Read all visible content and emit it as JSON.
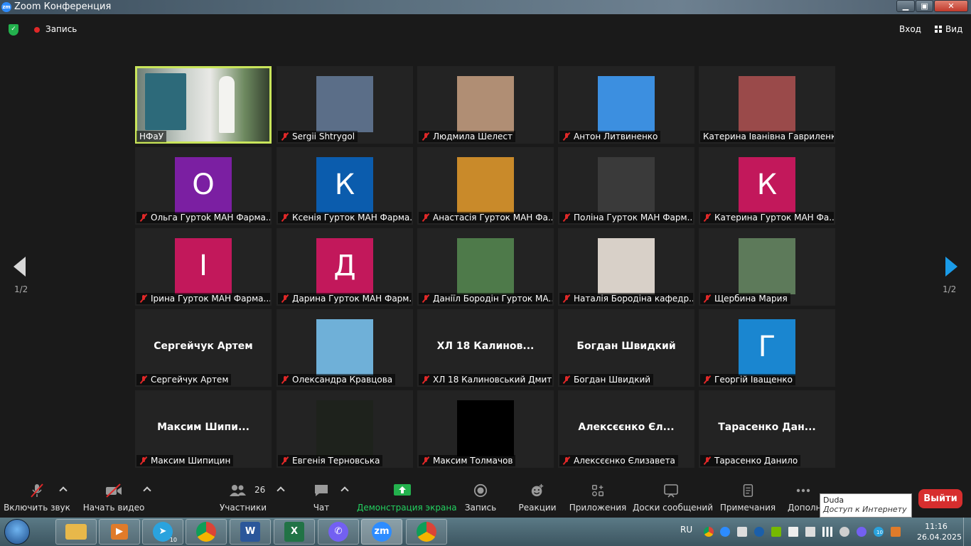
{
  "window": {
    "title": "Zoom Конференция"
  },
  "topbar": {
    "record_label": "Запись",
    "sign_in": "Вход",
    "view_label": "Вид"
  },
  "pagination": {
    "left": "1/2",
    "right": "1/2"
  },
  "participants": [
    {
      "name": "НФаУ",
      "big": "",
      "letter": "",
      "muted": false,
      "active": true,
      "kind": "video"
    },
    {
      "name": "Sergii Shtrygol",
      "big": "",
      "letter": "",
      "muted": true,
      "kind": "photo",
      "color": "#5b6e88"
    },
    {
      "name": "Людмила Шелест",
      "big": "",
      "letter": "",
      "muted": true,
      "kind": "photo",
      "color": "#b08e74"
    },
    {
      "name": "Антон Литвиненко",
      "big": "",
      "letter": "",
      "muted": true,
      "kind": "photo",
      "color": "#3c8fe0"
    },
    {
      "name": "Катерина Іванівна Гавриленко",
      "big": "",
      "letter": "",
      "muted": false,
      "kind": "photo",
      "color": "#9a4a4a"
    },
    {
      "name": "Ольга Гуртоk МАН Фарма...",
      "big": "",
      "letter": "О",
      "muted": true,
      "kind": "letter",
      "color": "#7b1fa2"
    },
    {
      "name": "Ксенія Гурток МАН Фарма...",
      "big": "",
      "letter": "К",
      "muted": true,
      "kind": "letter",
      "color": "#0b5cad"
    },
    {
      "name": "Анастасія Гурток МАН Фа...",
      "big": "",
      "letter": "",
      "muted": true,
      "kind": "photo",
      "color": "#c98a2a"
    },
    {
      "name": "Поліна Гурток МАН Фарм...",
      "big": "",
      "letter": "",
      "muted": true,
      "kind": "photo",
      "color": "#3a3a3a"
    },
    {
      "name": "Катерина Гурток МАН Фа...",
      "big": "",
      "letter": "К",
      "muted": true,
      "kind": "letter",
      "color": "#c2185b"
    },
    {
      "name": "Ірина Гурток МАН Фарма...",
      "big": "",
      "letter": "І",
      "muted": true,
      "kind": "letter",
      "color": "#c2185b"
    },
    {
      "name": "Дарина Гурток МАН Фарм...",
      "big": "",
      "letter": "Д",
      "muted": true,
      "kind": "letter",
      "color": "#c2185b"
    },
    {
      "name": "Даніїл Бородін Гурток МА...",
      "big": "",
      "letter": "",
      "muted": true,
      "kind": "photo",
      "color": "#4e7a4a"
    },
    {
      "name": "Наталія Бородіна кафедр...",
      "big": "",
      "letter": "",
      "muted": true,
      "kind": "photo",
      "color": "#d8d0c8"
    },
    {
      "name": "Щербина Мария",
      "big": "",
      "letter": "",
      "muted": true,
      "kind": "photo",
      "color": "#5d7a5a"
    },
    {
      "name": "Сергейчук Артем",
      "big": "Сергейчук Артем",
      "letter": "",
      "muted": true,
      "kind": "text"
    },
    {
      "name": "Олександра Кравцова",
      "big": "",
      "letter": "",
      "muted": true,
      "kind": "photo",
      "color": "#6fb0d8"
    },
    {
      "name": "ХЛ 18 Калиновський Дмит...",
      "big": "ХЛ 18 Калинов...",
      "letter": "",
      "muted": true,
      "kind": "text"
    },
    {
      "name": "Богдан Швидкий",
      "big": "Богдан Швидкий",
      "letter": "",
      "muted": true,
      "kind": "text"
    },
    {
      "name": "Георгій Іващенко",
      "big": "",
      "letter": "Г",
      "muted": true,
      "kind": "letter",
      "color": "#1a86d0"
    },
    {
      "name": "Максим Шипицин",
      "big": "Максим  Шипи...",
      "letter": "",
      "muted": true,
      "kind": "text"
    },
    {
      "name": "Евгенія Терновська",
      "big": "",
      "letter": "",
      "muted": true,
      "kind": "photo",
      "color": "#1e221c"
    },
    {
      "name": "Максим Толмачов",
      "big": "",
      "letter": "",
      "muted": true,
      "kind": "photo",
      "color": "#000000"
    },
    {
      "name": "Алексєєнко Єлизавета",
      "big": "Алексєєнко Єл...",
      "letter": "",
      "muted": true,
      "kind": "text"
    },
    {
      "name": "Тарасенко Данило",
      "big": "Тарасенко  Дан...",
      "letter": "",
      "muted": true,
      "kind": "text"
    }
  ],
  "toolbar": {
    "unmute": "Включить звук",
    "start_video": "Начать видео",
    "participants_count": "26",
    "participants": "Участники",
    "chat": "Чат",
    "share_screen": "Демонстрация экрана",
    "record": "Запись",
    "reactions": "Реакции",
    "apps": "Приложения",
    "whiteboards": "Доски сообщений",
    "notes": "Примечания",
    "more": "Дополн",
    "leave": "Выйти"
  },
  "tooltip": {
    "line1": "Duda",
    "line2": "Доступ к Интернету"
  },
  "taskbar": {
    "language": "RU",
    "time": "11:16",
    "date": "26.04.2025",
    "telegram_badge": "10",
    "tray_badge": "10"
  }
}
